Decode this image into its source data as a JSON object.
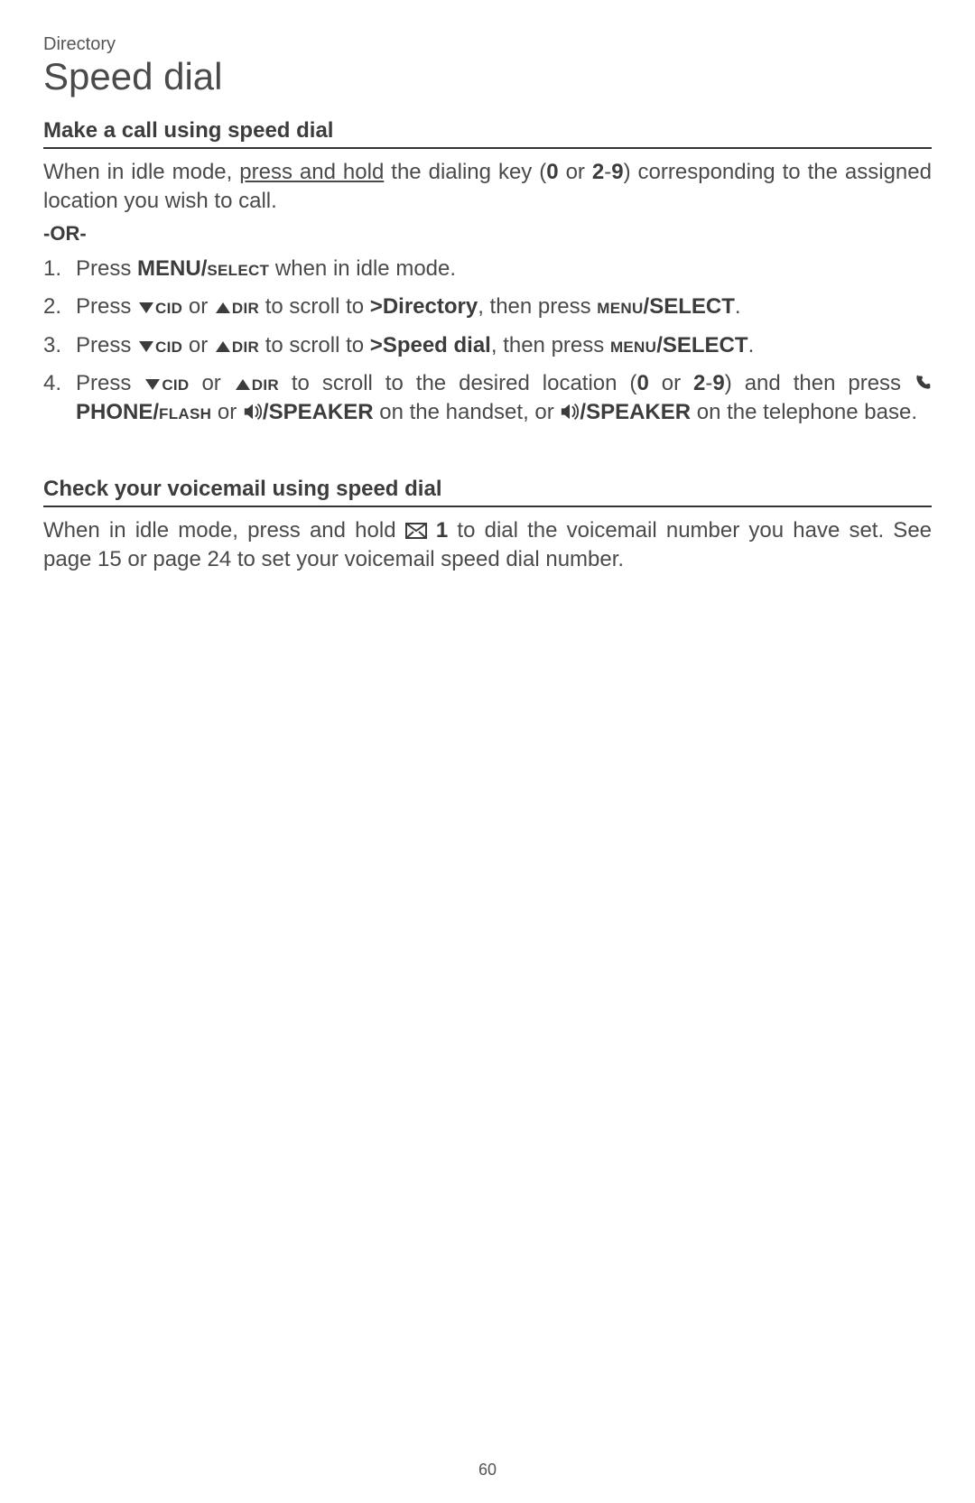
{
  "breadcrumb": "Directory",
  "page_title": "Speed dial",
  "page_number": "60",
  "labels": {
    "menu_uc": "MENU",
    "select_sc": "select",
    "menu_sc": "menu",
    "select_uc": "SELECT",
    "cid_sc": "cid",
    "dir_sc": "dir",
    "phone_uc": "PHONE",
    "flash_sc": "flash",
    "speaker_uc": "SPEAKER"
  },
  "section_make_call": {
    "heading": "Make a call using speed dial",
    "intro_pre": "When in idle mode, ",
    "intro_underline": "press and hold",
    "intro_post1": " the dialing key (",
    "zero": "0",
    "intro_post2": " or ",
    "two": "2",
    "dash": "-",
    "nine": "9",
    "intro_post3": ") corresponding to the assigned location you wish to call.",
    "or_label": "-OR-",
    "step1_a": "Press ",
    "step1_b": " when in idle mode.",
    "step2_a": "Press ",
    "step2_b": " or ",
    "step2_c": " to scroll to ",
    "step2_target": ">Directory",
    "step2_d": ", then press ",
    "step2_e": ".",
    "step3_target": ">Speed dial",
    "step4_a": "Press ",
    "step4_b": " or ",
    "step4_c": " to scroll to the desired location (",
    "step4_zero": "0",
    "step4_or": " or ",
    "step4_two": "2",
    "step4_nine": "9",
    "step4_d": ") and then press ",
    "step4_e": " or ",
    "step4_f": " on the handset, or ",
    "step4_g": " on the telephone base."
  },
  "section_voicemail": {
    "heading": "Check your voicemail using speed dial",
    "text_a": "When in idle mode, press and hold ",
    "key1": "1",
    "text_b": " to dial the voicemail number you have set. See page 15 or page 24 to set your voicemail speed dial number."
  }
}
